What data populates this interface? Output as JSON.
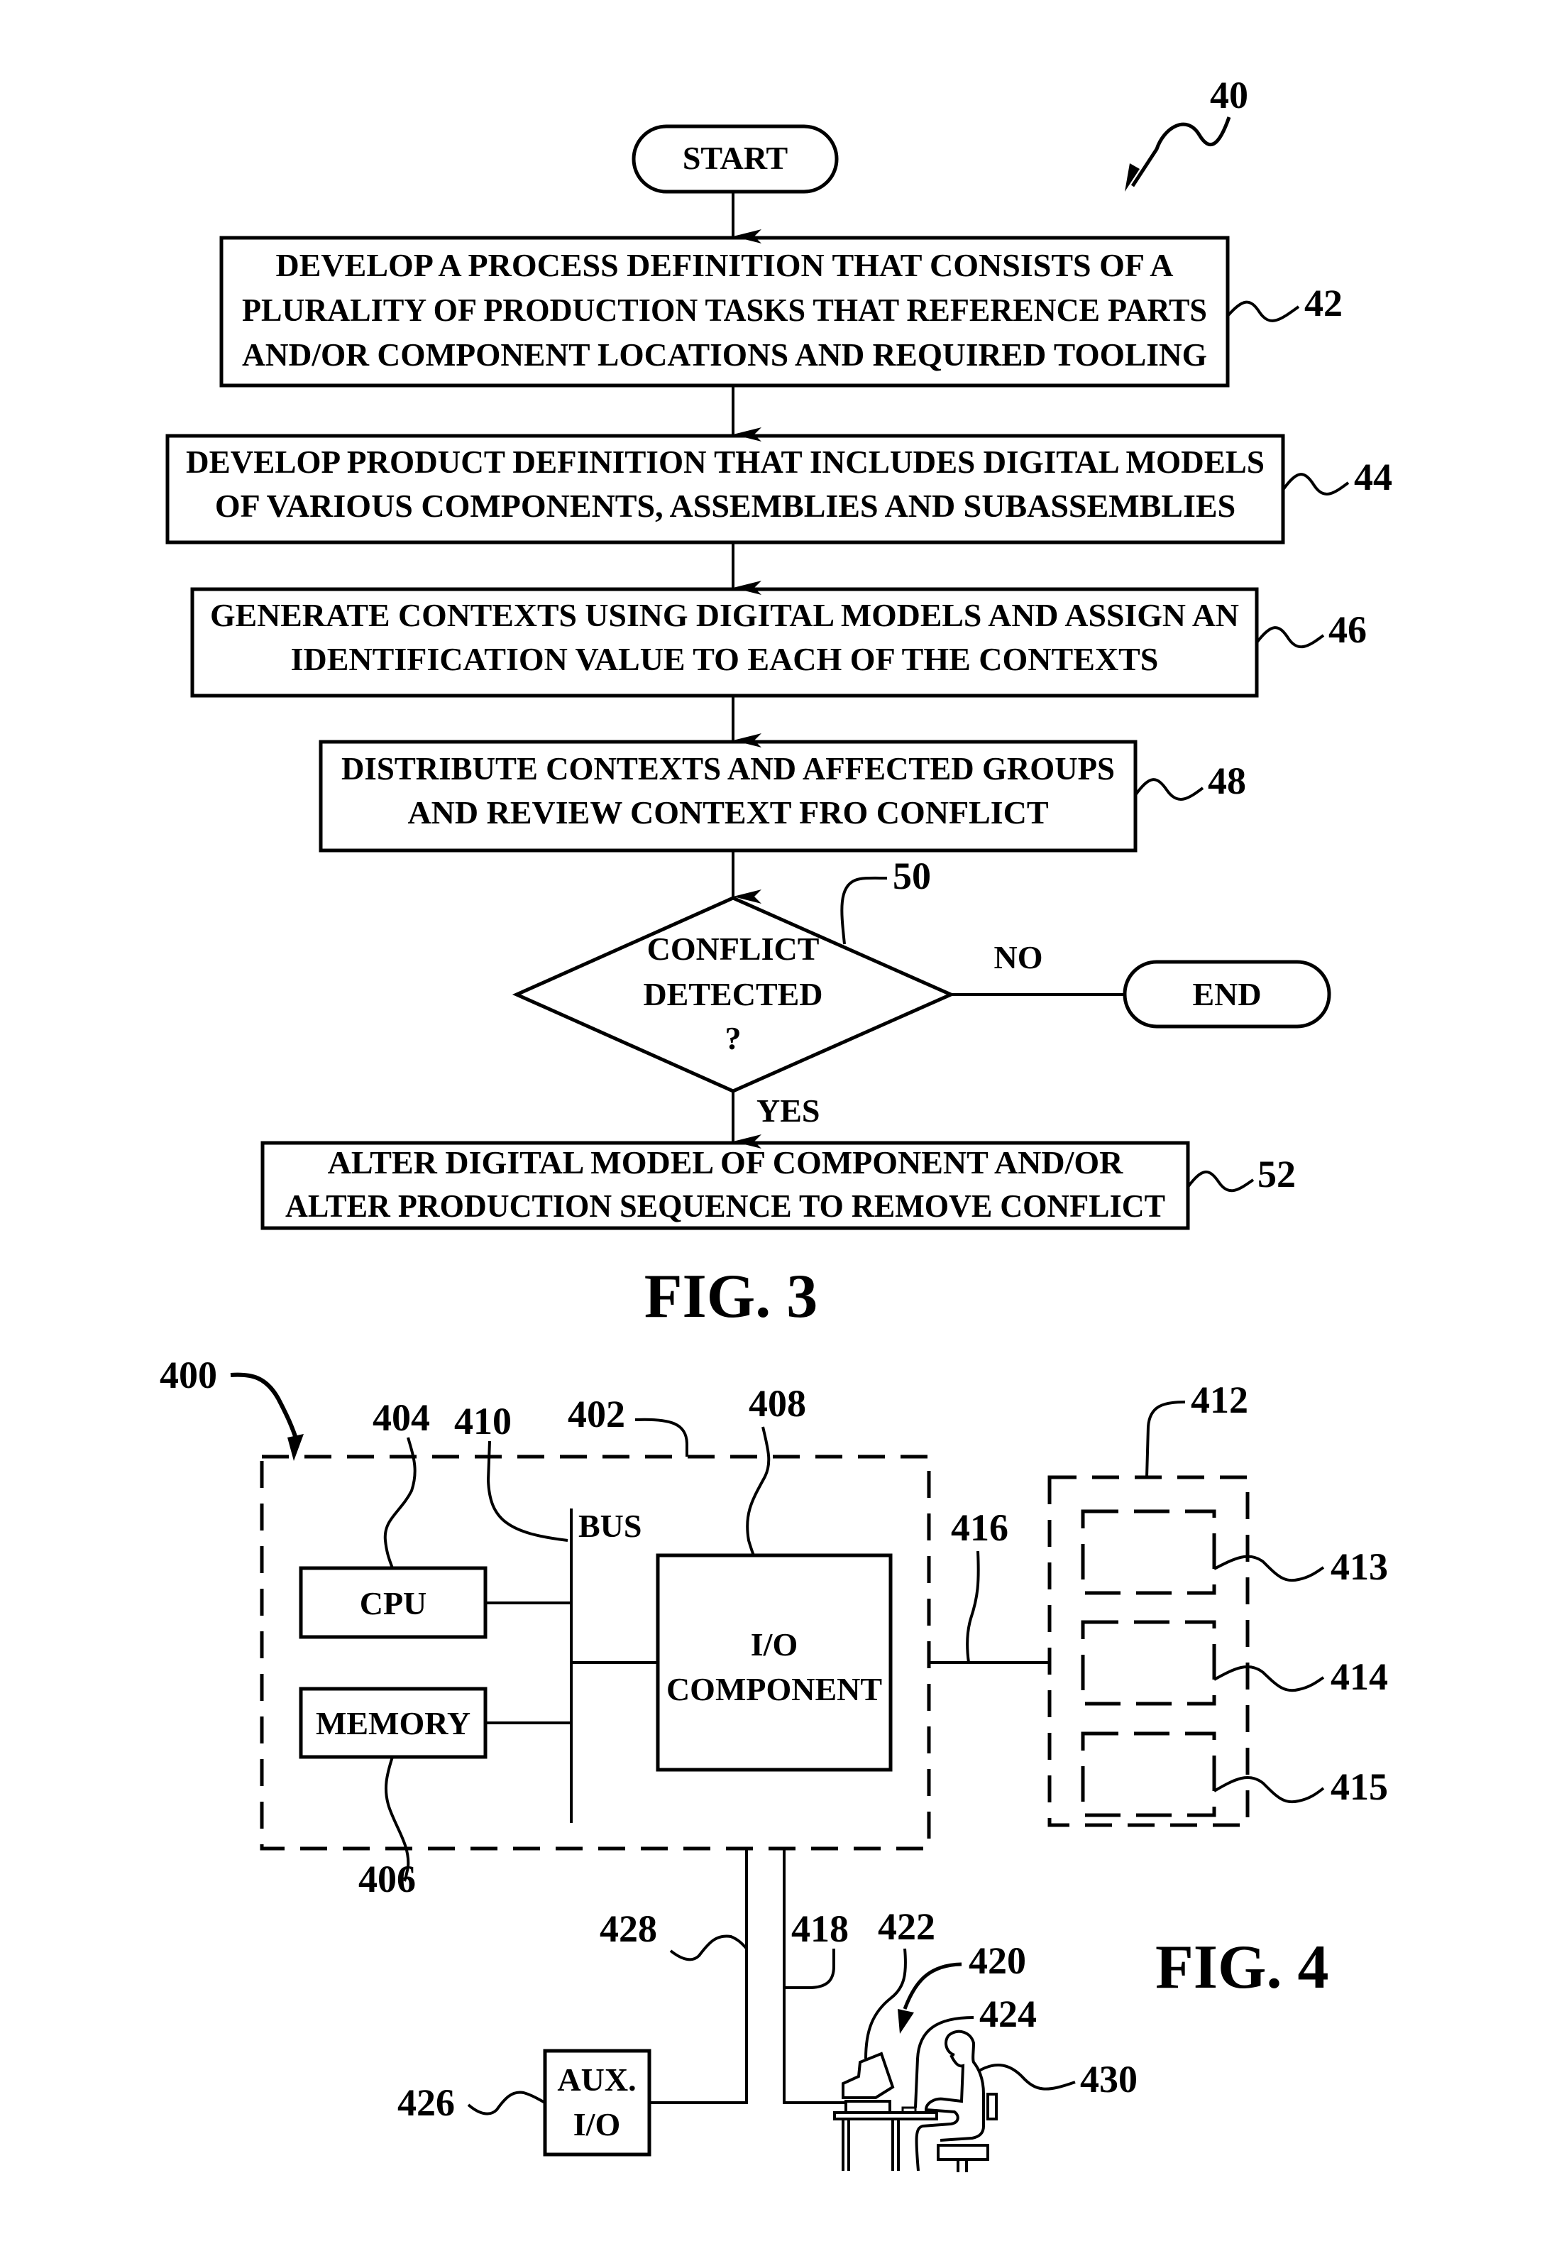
{
  "fig3": {
    "title": "FIG. 3",
    "ref_main": "40",
    "start": "START",
    "end": "END",
    "steps": [
      {
        "ref": "42",
        "lines": [
          "DEVELOP A PROCESS DEFINITION THAT CONSISTS OF A",
          "PLURALITY OF PRODUCTION TASKS THAT REFERENCE PARTS",
          "AND/OR COMPONENT LOCATIONS AND REQUIRED TOOLING"
        ]
      },
      {
        "ref": "44",
        "lines": [
          "DEVELOP PRODUCT DEFINITION THAT INCLUDES DIGITAL MODELS",
          "OF VARIOUS COMPONENTS, ASSEMBLIES AND SUBASSEMBLIES"
        ]
      },
      {
        "ref": "46",
        "lines": [
          "GENERATE CONTEXTS USING DIGITAL MODELS AND ASSIGN AN",
          "IDENTIFICATION VALUE TO EACH OF THE CONTEXTS"
        ]
      },
      {
        "ref": "48",
        "lines": [
          "DISTRIBUTE CONTEXTS AND AFFECTED GROUPS",
          "AND REVIEW CONTEXT FRO CONFLICT"
        ]
      }
    ],
    "decision": {
      "ref": "50",
      "lines": [
        "CONFLICT",
        "DETECTED",
        "?"
      ],
      "no_label": "NO",
      "yes_label": "YES"
    },
    "final_step": {
      "ref": "52",
      "lines": [
        "ALTER DIGITAL MODEL OF COMPONENT AND/OR",
        "ALTER PRODUCTION SEQUENCE TO REMOVE CONFLICT"
      ]
    }
  },
  "fig4": {
    "title": "FIG. 4",
    "refs": {
      "system": "400",
      "computer": "402",
      "cpu": "404",
      "memory": "406",
      "io_component": "408",
      "bus": "410",
      "storage": "412",
      "storage_1": "413",
      "storage_2": "414",
      "storage_3": "415",
      "link_storage": "416",
      "link_workstation": "418",
      "workstation": "420",
      "display": "422",
      "input_device": "424",
      "aux_io": "426",
      "link_aux": "428",
      "user": "430"
    },
    "labels": {
      "bus": "BUS",
      "cpu": "CPU",
      "memory": "MEMORY",
      "io_line1": "I/O",
      "io_line2": "COMPONENT",
      "aux_line1": "AUX.",
      "aux_line2": "I/O"
    }
  }
}
